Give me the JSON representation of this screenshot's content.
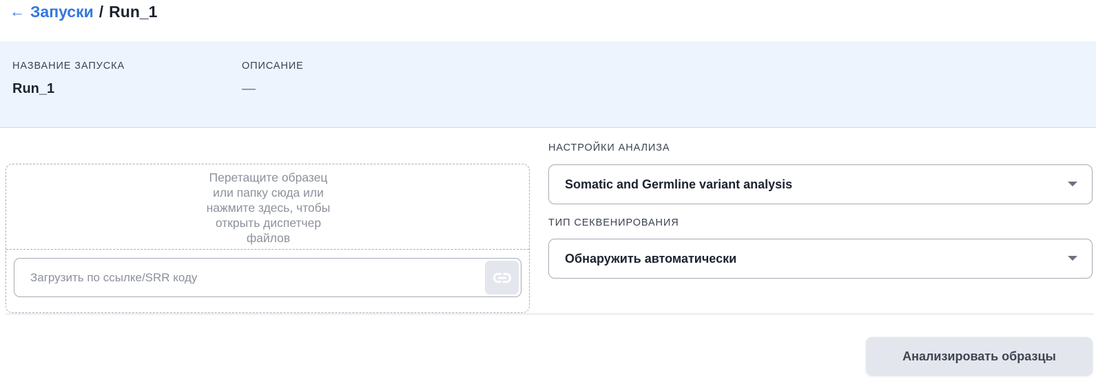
{
  "breadcrumb": {
    "back_arrow": "←",
    "parent": "Запуски",
    "separator": "/",
    "current": "Run_1"
  },
  "run_info": {
    "name_label": "НАЗВАНИЕ ЗАПУСКА",
    "name_value": "Run_1",
    "description_label": "ОПИСАНИЕ",
    "description_value": "—"
  },
  "upload": {
    "dropzone_lines": [
      "Перетащите образец",
      "или папку сюда или",
      "нажмите здесь, чтобы",
      "открыть диспетчер",
      "файлов"
    ],
    "url_input": {
      "value": "",
      "placeholder": "Загрузить по ссылке/SRR коду"
    },
    "link_icon": "link-icon"
  },
  "analysis": {
    "settings_label": "НАСТРОЙКИ АНАЛИЗА",
    "settings_selected": "Somatic and Germline variant analysis",
    "sequencing_label": "ТИП СЕКВЕНИРОВАНИЯ",
    "sequencing_selected": "Обнаружить автоматически",
    "dropdown_icon": "caret-down-icon"
  },
  "actions": {
    "analyze_label": "Анализировать образцы"
  },
  "colors": {
    "accent": "#3477e0",
    "info_band_bg": "#edf4fe",
    "button_disabled_bg": "#e3e6ec",
    "text_primary": "#1c2330",
    "text_muted": "#8c919b"
  }
}
